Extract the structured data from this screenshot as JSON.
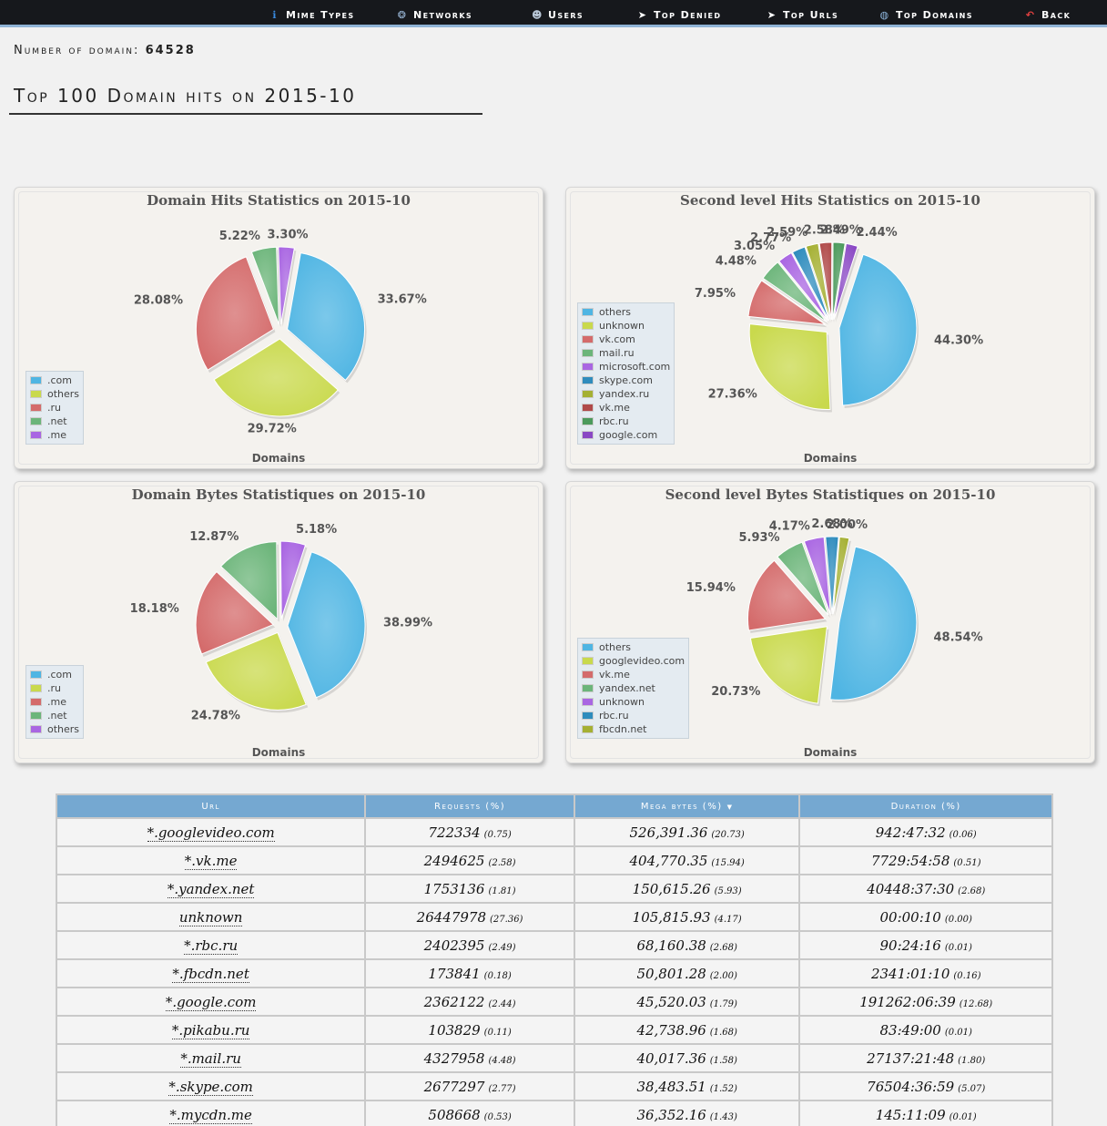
{
  "nav": {
    "items": [
      {
        "label": "Mime Types",
        "icon": "info-icon"
      },
      {
        "label": "Networks",
        "icon": "network-icon"
      },
      {
        "label": "Users",
        "icon": "user-icon"
      },
      {
        "label": "Top Denied",
        "icon": "cursor-icon"
      },
      {
        "label": "Top Urls",
        "icon": "cursor-icon"
      },
      {
        "label": "Top Domains",
        "icon": "globe-icon"
      },
      {
        "label": "Back",
        "icon": "back-arrow-icon"
      }
    ]
  },
  "summary": {
    "domain_count_label": "Number of domain:",
    "domain_count_value": "64528"
  },
  "page_title": "Top 100 Domain hits on 2015-10",
  "chart_data": [
    {
      "type": "pie",
      "title": "Domain Hits Statistics on 2015-10",
      "xlabel": "Domains",
      "legend_position": "bottom-left",
      "slices": [
        {
          "name": ".com",
          "value": 33.67,
          "color": "#4fb5e3"
        },
        {
          "name": "others",
          "value": 29.72,
          "color": "#c9d94d"
        },
        {
          "name": ".ru",
          "value": 28.08,
          "color": "#d46b6b"
        },
        {
          "name": ".net",
          "value": 5.22,
          "color": "#6cb57a"
        },
        {
          "name": ".me",
          "value": 3.3,
          "color": "#a966e2"
        }
      ]
    },
    {
      "type": "pie",
      "title": "Second level Hits Statistics on 2015-10",
      "xlabel": "Domains",
      "legend_position": "left",
      "slices": [
        {
          "name": "others",
          "value": 44.3,
          "color": "#4fb5e3"
        },
        {
          "name": "unknown",
          "value": 27.36,
          "color": "#c9d94d"
        },
        {
          "name": "vk.com",
          "value": 7.95,
          "color": "#d46b6b"
        },
        {
          "name": "mail.ru",
          "value": 4.48,
          "color": "#6cb57a"
        },
        {
          "name": "microsoft.com",
          "value": 3.05,
          "color": "#a966e2"
        },
        {
          "name": "skype.com",
          "value": 2.77,
          "color": "#2f8cbd"
        },
        {
          "name": "yandex.ru",
          "value": 2.59,
          "color": "#a5b033"
        },
        {
          "name": "vk.me",
          "value": 2.58,
          "color": "#b04a4a"
        },
        {
          "name": "rbc.ru",
          "value": 2.49,
          "color": "#4c9a5c"
        },
        {
          "name": "google.com",
          "value": 2.44,
          "color": "#8a48c4"
        }
      ]
    },
    {
      "type": "pie",
      "title": "Domain Bytes Statistiques on 2015-10",
      "xlabel": "Domains",
      "legend_position": "bottom-left",
      "slices": [
        {
          "name": ".com",
          "value": 38.99,
          "color": "#4fb5e3"
        },
        {
          "name": ".ru",
          "value": 24.78,
          "color": "#c9d94d"
        },
        {
          "name": ".me",
          "value": 18.18,
          "color": "#d46b6b"
        },
        {
          "name": ".net",
          "value": 12.87,
          "color": "#6cb57a"
        },
        {
          "name": "others",
          "value": 5.18,
          "color": "#a966e2"
        }
      ]
    },
    {
      "type": "pie",
      "title": "Second level Bytes Statistiques on 2015-10",
      "xlabel": "Domains",
      "legend_position": "left",
      "slices": [
        {
          "name": "others",
          "value": 48.54,
          "color": "#4fb5e3"
        },
        {
          "name": "googlevideo.com",
          "value": 20.73,
          "color": "#c9d94d"
        },
        {
          "name": "vk.me",
          "value": 15.94,
          "color": "#d46b6b"
        },
        {
          "name": "yandex.net",
          "value": 5.93,
          "color": "#6cb57a"
        },
        {
          "name": "unknown",
          "value": 4.17,
          "color": "#a966e2"
        },
        {
          "name": "rbc.ru",
          "value": 2.68,
          "color": "#2f8cbd"
        },
        {
          "name": "fbcdn.net",
          "value": 2.0,
          "color": "#a5b033"
        }
      ]
    }
  ],
  "table": {
    "headers": [
      "Url",
      "Requests (%)",
      "Mega bytes (%)",
      "Duration (%)"
    ],
    "sort_indicator": "▼",
    "rows": [
      {
        "url": "*.googlevideo.com",
        "requests": "722334",
        "requests_pct": "(0.75)",
        "mb": "526,391.36",
        "mb_pct": "(20.73)",
        "duration": "942:47:32",
        "duration_pct": "(0.06)"
      },
      {
        "url": "*.vk.me",
        "requests": "2494625",
        "requests_pct": "(2.58)",
        "mb": "404,770.35",
        "mb_pct": "(15.94)",
        "duration": "7729:54:58",
        "duration_pct": "(0.51)"
      },
      {
        "url": "*.yandex.net",
        "requests": "1753136",
        "requests_pct": "(1.81)",
        "mb": "150,615.26",
        "mb_pct": "(5.93)",
        "duration": "40448:37:30",
        "duration_pct": "(2.68)"
      },
      {
        "url": "unknown",
        "requests": "26447978",
        "requests_pct": "(27.36)",
        "mb": "105,815.93",
        "mb_pct": "(4.17)",
        "duration": "00:00:10",
        "duration_pct": "(0.00)"
      },
      {
        "url": "*.rbc.ru",
        "requests": "2402395",
        "requests_pct": "(2.49)",
        "mb": "68,160.38",
        "mb_pct": "(2.68)",
        "duration": "90:24:16",
        "duration_pct": "(0.01)"
      },
      {
        "url": "*.fbcdn.net",
        "requests": "173841",
        "requests_pct": "(0.18)",
        "mb": "50,801.28",
        "mb_pct": "(2.00)",
        "duration": "2341:01:10",
        "duration_pct": "(0.16)"
      },
      {
        "url": "*.google.com",
        "requests": "2362122",
        "requests_pct": "(2.44)",
        "mb": "45,520.03",
        "mb_pct": "(1.79)",
        "duration": "191262:06:39",
        "duration_pct": "(12.68)"
      },
      {
        "url": "*.pikabu.ru",
        "requests": "103829",
        "requests_pct": "(0.11)",
        "mb": "42,738.96",
        "mb_pct": "(1.68)",
        "duration": "83:49:00",
        "duration_pct": "(0.01)"
      },
      {
        "url": "*.mail.ru",
        "requests": "4327958",
        "requests_pct": "(4.48)",
        "mb": "40,017.36",
        "mb_pct": "(1.58)",
        "duration": "27137:21:48",
        "duration_pct": "(1.80)"
      },
      {
        "url": "*.skype.com",
        "requests": "2677297",
        "requests_pct": "(2.77)",
        "mb": "38,483.51",
        "mb_pct": "(1.52)",
        "duration": "76504:36:59",
        "duration_pct": "(5.07)"
      },
      {
        "url": "*.mycdn.me",
        "requests": "508668",
        "requests_pct": "(0.53)",
        "mb": "36,352.16",
        "mb_pct": "(1.43)",
        "duration": "145:11:09",
        "duration_pct": "(0.01)"
      }
    ]
  }
}
